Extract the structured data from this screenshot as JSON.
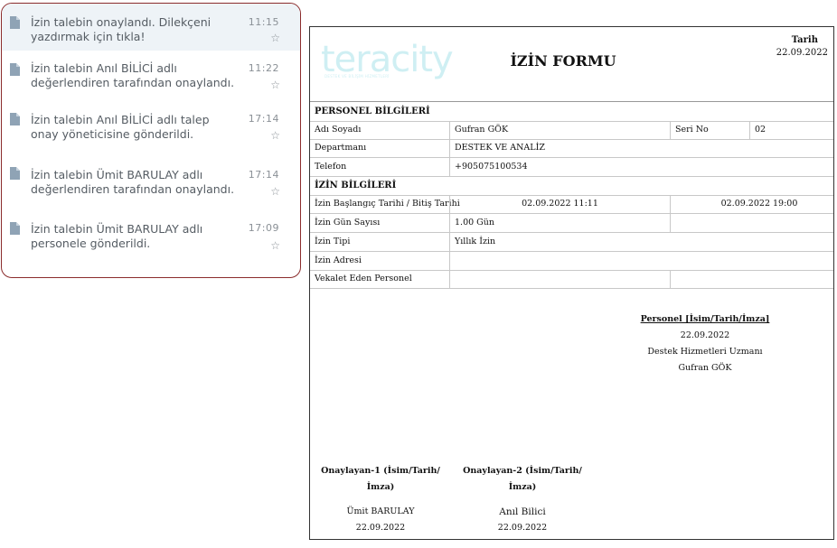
{
  "notifications": [
    {
      "text": "İzin talebin onaylandı. Dilekçeni yazdırmak için tıkla!",
      "time": "11:15"
    },
    {
      "text": "İzin talebin Anıl BİLİCİ adlı değerlendiren tarafından onaylandı.",
      "time": "11:22"
    },
    {
      "text": "İzin talebin Anıl BİLİCİ adlı talep onay yöneticisine gönderildi.",
      "time": "17:14"
    },
    {
      "text": "İzin talebin Ümit BARULAY adlı değerlendiren tarafından onaylandı.",
      "time": "17:14"
    },
    {
      "text": "İzin talebin Ümit BARULAY adlı personele gönderildi.",
      "time": "17:09"
    }
  ],
  "form": {
    "logo_text": "teracity",
    "logo_subtext": "DESTEK VE BİLİŞİM HİZMETLERİ",
    "title": "İZİN FORMU",
    "date_label": "Tarih",
    "date_value": "22.09.2022",
    "personel_section": "PERSONEL BİLGİLERİ",
    "name_label": "Adı Soyadı",
    "name_value": "Gufran GÖK",
    "serial_label": "Seri No",
    "serial_value": "02",
    "department_label": "Departmanı",
    "department_value": "DESTEK VE ANALİZ",
    "phone_label": "Telefon",
    "phone_value": "+905075100534",
    "leave_section": "İZİN BİLGİLERİ",
    "dates_label": "İzin Başlangıç Tarihi / Bitiş Tarihi",
    "start_value": "02.09.2022 11:11",
    "end_value": "02.09.2022 19:00",
    "days_label": "İzin Gün Sayısı",
    "days_value": "1.00 Gün",
    "type_label": "İzin Tipi",
    "type_value": "Yıllık İzin",
    "address_label": "İzin Adresi",
    "address_value": "",
    "proxy_label": "Vekalet Eden Personel",
    "proxy_value": "",
    "personel_sig": {
      "heading": "Personel [İsim/Tarih/İmza]",
      "date": "22.09.2022",
      "role": "Destek Hizmetleri Uzmanı",
      "name": "Gufran GÖK"
    },
    "approver1": {
      "heading": "Onaylayan-1 (İsim/Tarih/İmza)",
      "name": "Ümit BARULAY",
      "date": "22.09.2022"
    },
    "approver2": {
      "heading": "Onaylayan-2 (İsim/Tarih/İmza)",
      "name": "Anıl Bilici",
      "date": "22.09.2022"
    }
  },
  "colors": {
    "panel_border": "#8b2c2c",
    "highlight_bg": "#eef3f7",
    "icon": "#8fa3b5",
    "logo": "#cfeff3"
  },
  "icons": {
    "notification": "document-icon",
    "favorite": "star-outline-icon"
  }
}
